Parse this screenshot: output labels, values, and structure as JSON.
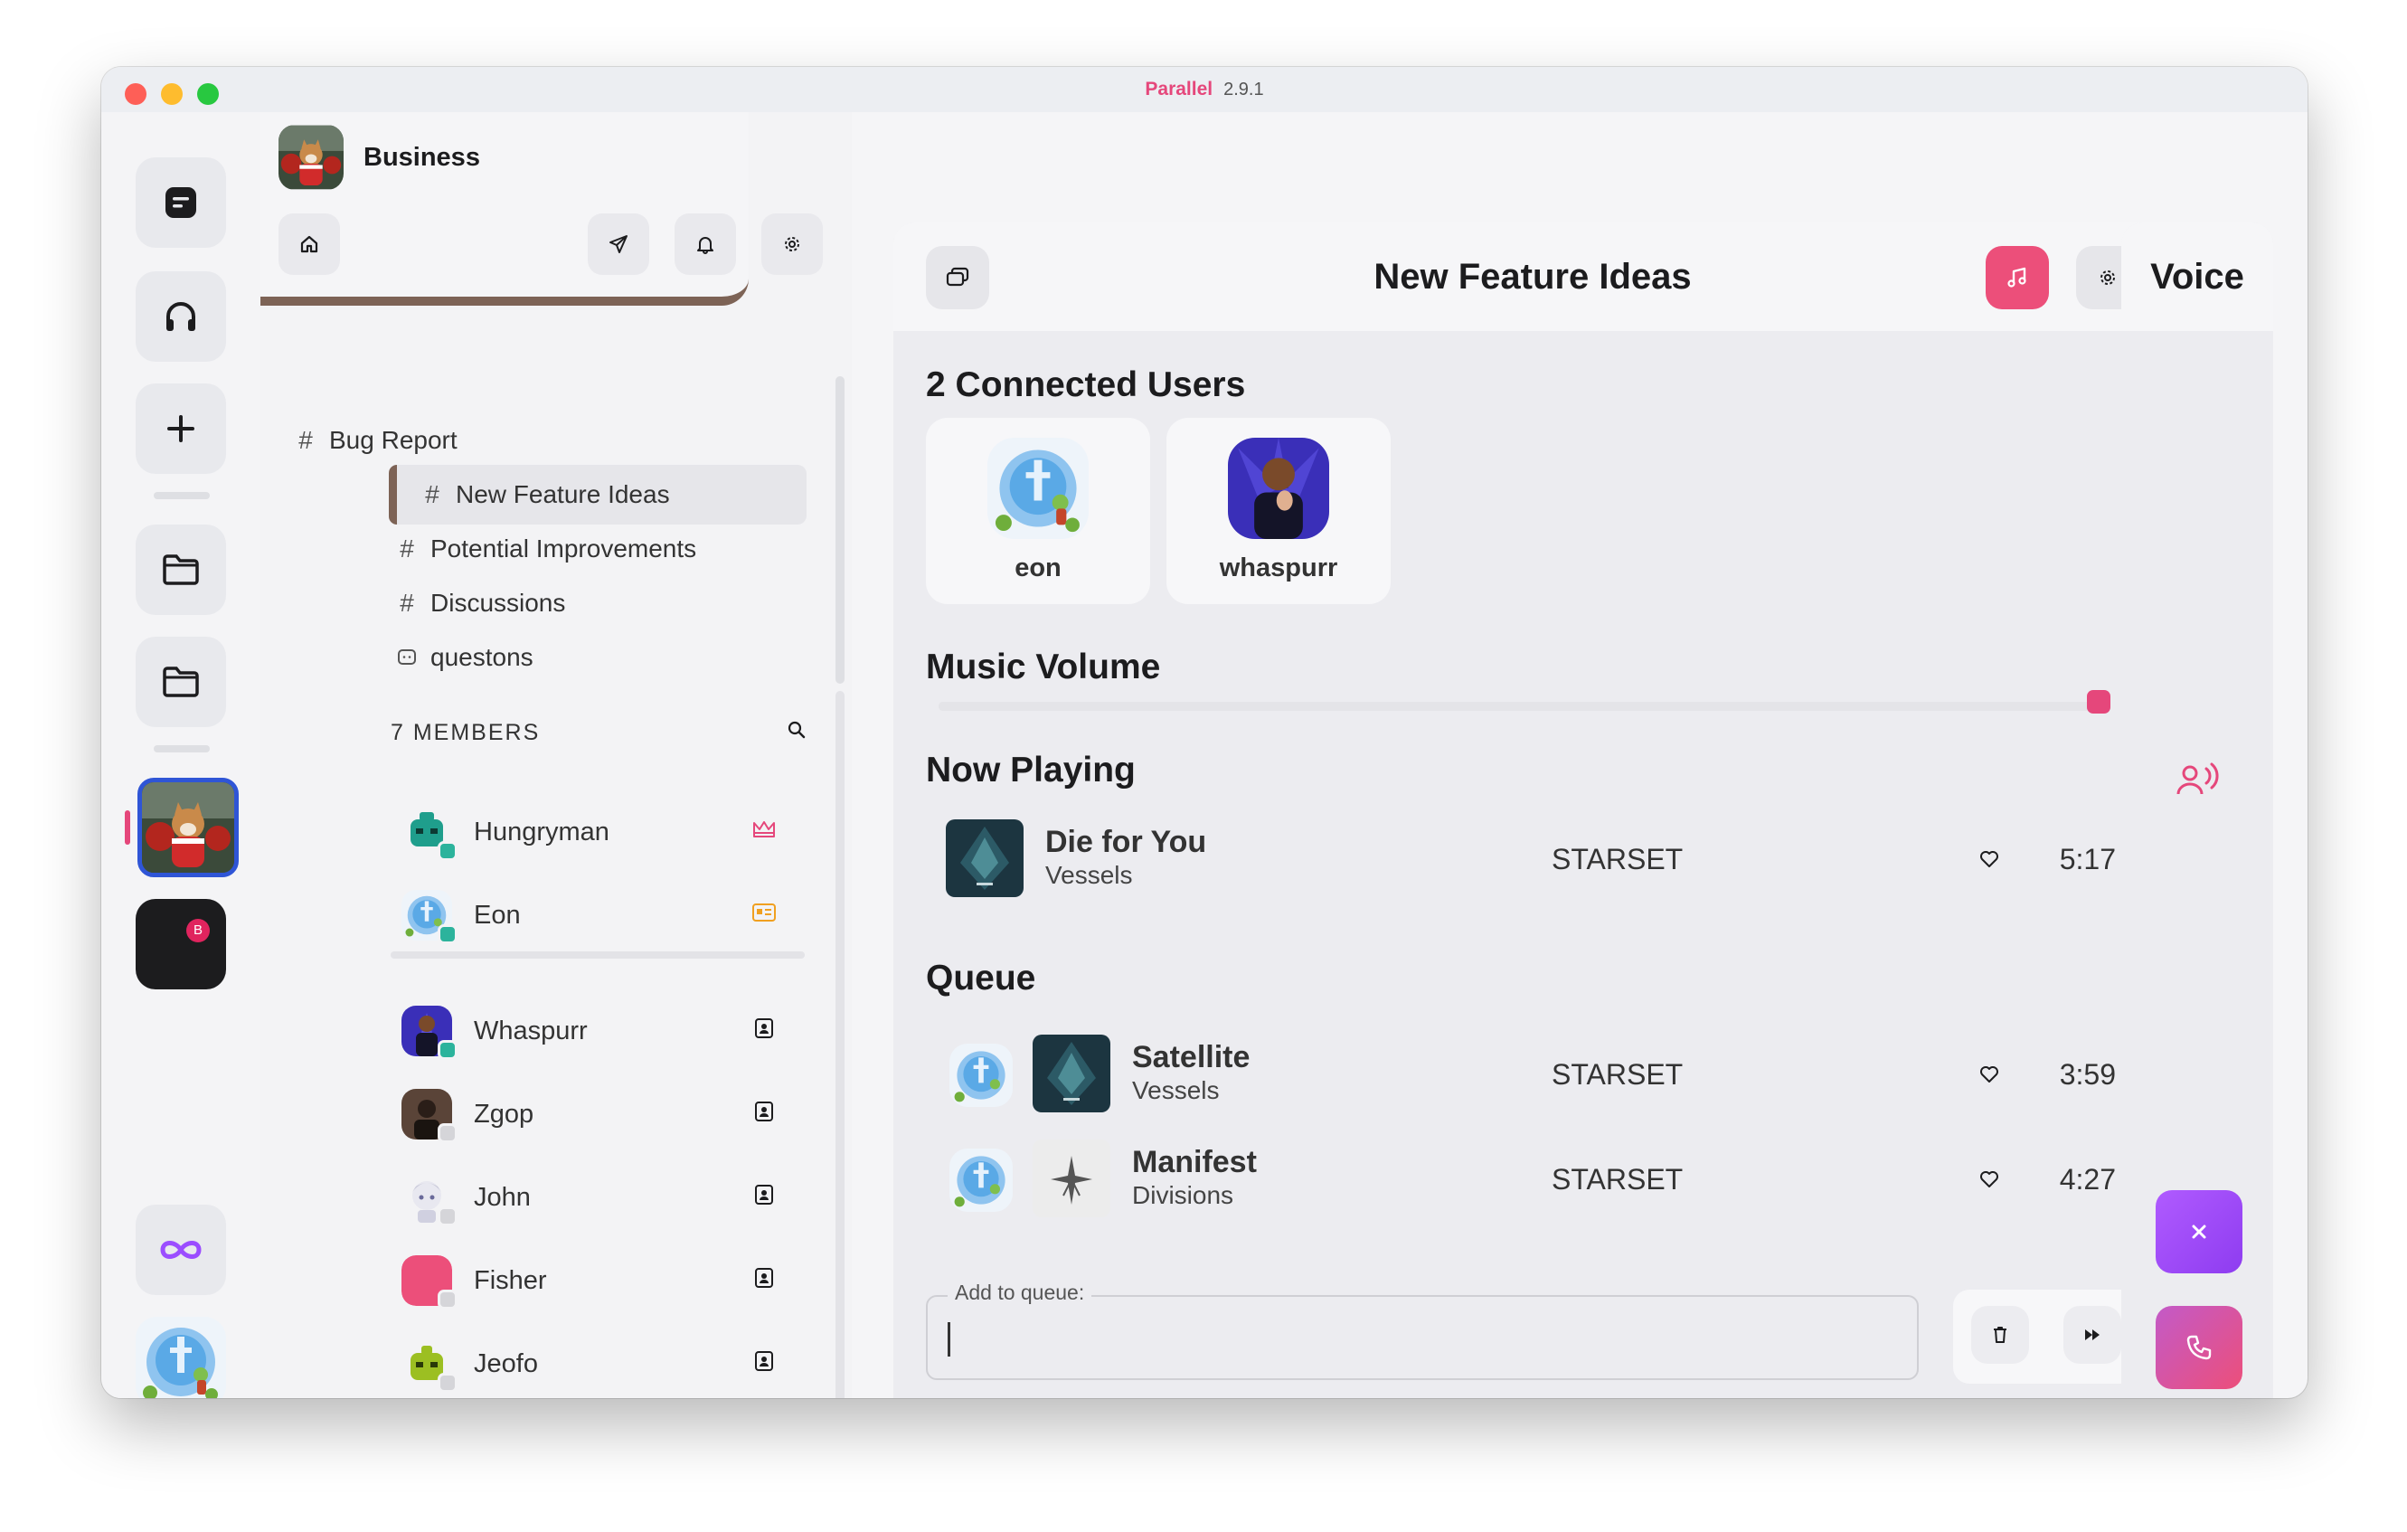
{
  "titlebar": {
    "app_name": "Parallel",
    "version": "2.9.1"
  },
  "server": {
    "name": "Business",
    "channels": [
      {
        "label": "Bug Report",
        "type": "text"
      },
      {
        "label": "New Feature Ideas",
        "type": "text",
        "active": true
      },
      {
        "label": "Potential Improvements",
        "type": "text"
      },
      {
        "label": "Discussions",
        "type": "text"
      },
      {
        "label": "questons",
        "type": "forum"
      }
    ],
    "members_label": "7 MEMBERS",
    "members": [
      {
        "name": "Hungryman",
        "status": "online",
        "badge": "crown-icon"
      },
      {
        "name": "Eon",
        "status": "online",
        "badge": "id-card-icon"
      },
      {
        "name": "Whaspurr",
        "status": "online",
        "badge": "contact-icon"
      },
      {
        "name": "Zgop",
        "status": "offline",
        "badge": "contact-icon"
      },
      {
        "name": "John",
        "status": "offline",
        "badge": "contact-icon"
      },
      {
        "name": "Fisher",
        "status": "offline",
        "badge": "contact-icon"
      },
      {
        "name": "Jeofo",
        "status": "offline",
        "badge": "contact-icon"
      }
    ]
  },
  "rail": {
    "server_b_badge": "B"
  },
  "main": {
    "title": "New Feature Ideas",
    "connected_title": "2 Connected Users",
    "connected_users": [
      {
        "name": "eon"
      },
      {
        "name": "whaspurr"
      }
    ],
    "volume_title": "Music Volume",
    "volume_level": 1.0,
    "now_playing_title": "Now Playing",
    "now_playing": {
      "title": "Die for You",
      "album": "Vessels",
      "artist": "STARSET",
      "duration": "5:17",
      "more": "···"
    },
    "queue_title": "Queue",
    "queue": [
      {
        "title": "Satellite",
        "album": "Vessels",
        "artist": "STARSET",
        "duration": "3:59",
        "more": "···"
      },
      {
        "title": "Manifest",
        "album": "Divisions",
        "artist": "STARSET",
        "duration": "4:27",
        "more": "···"
      }
    ],
    "add_to_queue_label": "Add to queue:",
    "add_to_queue_value": ""
  },
  "voice": {
    "title": "Voice"
  },
  "colors": {
    "accent": "#e5477b",
    "purple": "#9b4dff",
    "brown": "#7d6356",
    "online": "#2cb39c"
  }
}
